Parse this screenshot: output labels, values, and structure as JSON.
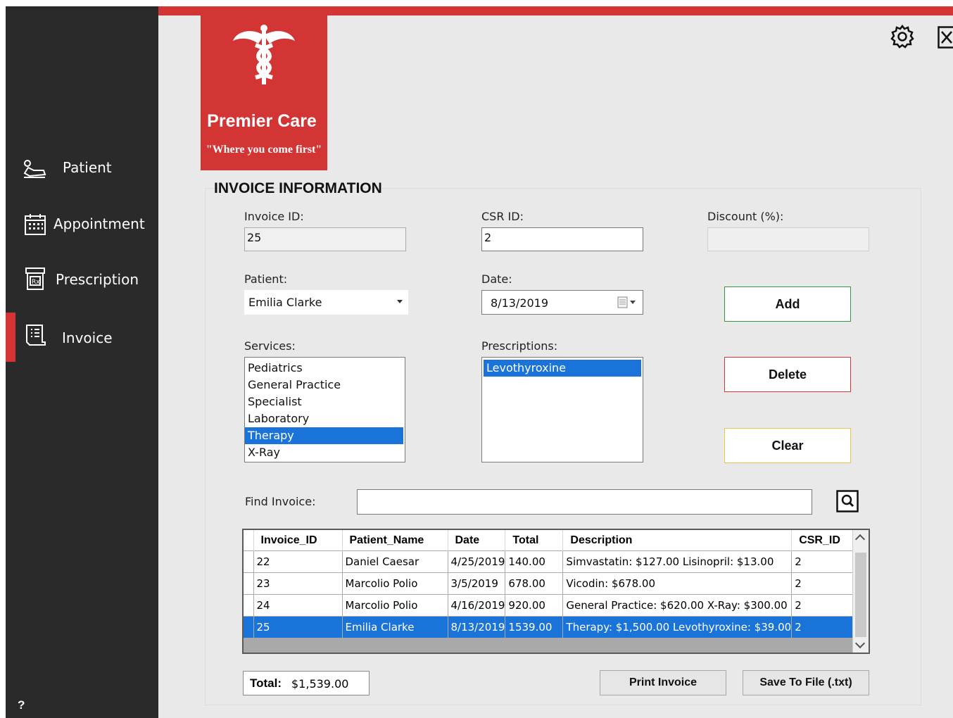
{
  "brand": {
    "name": "Premier Care",
    "tagline": "\"Where you come first\"",
    "color": "#d33434"
  },
  "sidebar": {
    "items": [
      {
        "label": "Patient",
        "icon": "patient-bed-icon"
      },
      {
        "label": "Appointment",
        "icon": "calendar-icon"
      },
      {
        "label": "Prescription",
        "icon": "prescription-icon"
      },
      {
        "label": "Invoice",
        "icon": "invoice-icon"
      }
    ],
    "active": "Invoice",
    "help": "?"
  },
  "section_title": "INVOICE INFORMATION",
  "form": {
    "invoice_id_label": "Invoice ID:",
    "invoice_id_value": "25",
    "csr_id_label": "CSR ID:",
    "csr_id_value": "2",
    "discount_label": "Discount (%):",
    "discount_value": "",
    "patient_label": "Patient:",
    "patient_value": "Emilia Clarke",
    "date_label": "Date:",
    "date_value": "8/13/2019",
    "services_label": "Services:",
    "services": [
      "Pediatrics",
      "General Practice",
      "Specialist",
      "Laboratory",
      "Therapy",
      "X-Ray"
    ],
    "services_selected": "Therapy",
    "prescriptions_label": "Prescriptions:",
    "prescriptions": [
      "Levothyroxine"
    ],
    "prescriptions_selected": "Levothyroxine",
    "find_label": "Find Invoice:",
    "find_value": ""
  },
  "buttons": {
    "add": "Add",
    "delete": "Delete",
    "clear": "Clear",
    "print": "Print Invoice",
    "save": "Save To File (.txt)",
    "add_color": "#2e9a3a",
    "delete_color": "#d33434",
    "clear_color": "#e8c84a"
  },
  "grid": {
    "columns": [
      "Invoice_ID",
      "Patient_Name",
      "Date",
      "Total",
      "Description",
      "CSR_ID"
    ],
    "rows": [
      [
        "22",
        "Daniel Caesar",
        "4/25/2019",
        "140.00",
        "Simvastatin: $127.00 Lisinopril: $13.00",
        "2"
      ],
      [
        "23",
        "Marcolio Polio",
        "3/5/2019",
        "678.00",
        "Vicodin: $678.00",
        "2"
      ],
      [
        "24",
        "Marcolio Polio",
        "4/16/2019",
        "920.00",
        "General Practice: $620.00 X-Ray: $300.00",
        "2"
      ],
      [
        "25",
        "Emilia Clarke",
        "8/13/2019",
        "1539.00",
        "Therapy: $1,500.00 Levothyroxine: $39.00",
        "2"
      ]
    ],
    "selected_row": 3
  },
  "total": {
    "label": "Total:",
    "value": "$1,539.00"
  }
}
